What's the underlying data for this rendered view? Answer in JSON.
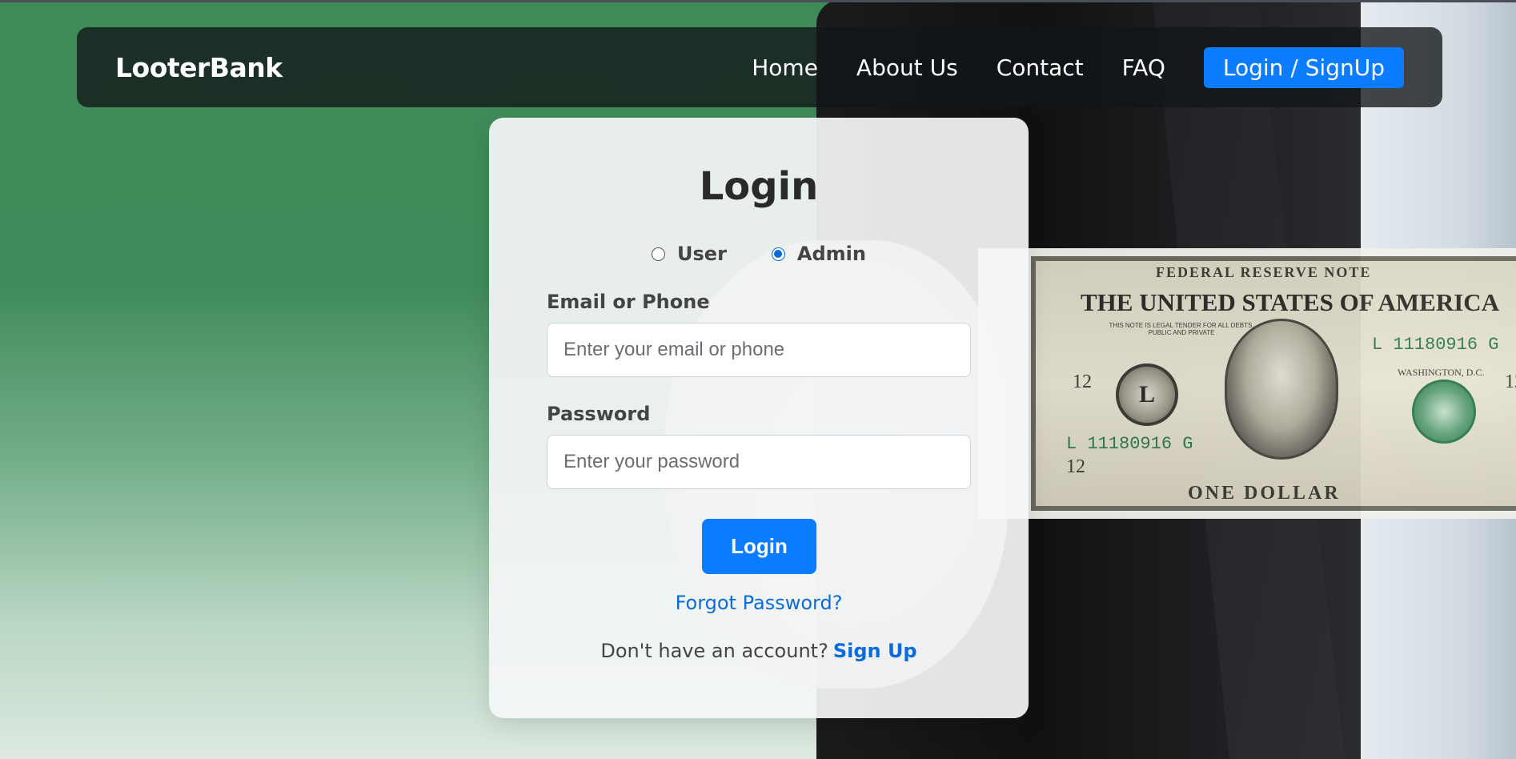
{
  "navbar": {
    "brand": "LooterBank",
    "links": [
      {
        "label": "Home"
      },
      {
        "label": "About Us"
      },
      {
        "label": "Contact"
      },
      {
        "label": "FAQ"
      }
    ],
    "cta_label": "Login / SignUp"
  },
  "login": {
    "title": "Login",
    "roles": [
      {
        "label": "User",
        "checked": false
      },
      {
        "label": "Admin",
        "checked": true
      }
    ],
    "email_label": "Email or Phone",
    "email_placeholder": "Enter your email or phone",
    "email_value": "",
    "password_label": "Password",
    "password_placeholder": "Enter your password",
    "password_value": "",
    "submit_label": "Login",
    "forgot_label": "Forgot Password?",
    "signup_prompt": "Don't have an account?",
    "signup_label": "Sign Up"
  },
  "background_bill": {
    "top_text": "FEDERAL RESERVE NOTE",
    "title": "THE UNITED STATES OF AMERICA",
    "legal_text": "THIS NOTE IS LEGAL TENDER FOR ALL DEBTS, PUBLIC AND PRIVATE",
    "serial": "L 11180916 G",
    "city": "WASHINGTON, D.C.",
    "district_number": "12",
    "seal_letter": "L",
    "bottom_text": "ONE DOLLAR"
  },
  "colors": {
    "accent": "#0a7cff",
    "link": "#0a6cdc",
    "navbar_bg": "#121618",
    "green_bg": "#418c5a"
  }
}
